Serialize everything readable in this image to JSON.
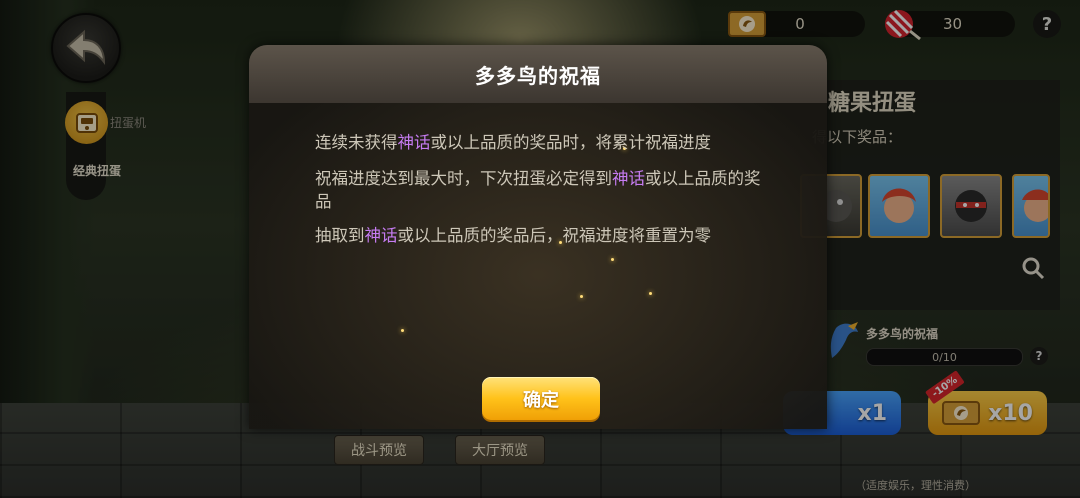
{
  "topbar": {
    "back_icon": "back-arrow-icon",
    "ticket_count": "0",
    "candy_count": "30",
    "help_label": "?"
  },
  "sidebar": {
    "tab_small_label": "扭蛋机",
    "tab_main_label": "经典扭蛋"
  },
  "panel": {
    "title": "糖果扭蛋",
    "subtitle": "得以下奖品：",
    "blessing_title": "多多鸟的祝福",
    "blessing_progress": "0/10",
    "blessing_progress_value": 0,
    "blessing_help": "?",
    "draw_x1_label": "x1",
    "draw_x10_label": "x10",
    "discount_label": "-10%",
    "footer_note": "（适度娱乐，理性消费）"
  },
  "bottom_buttons": {
    "battle_preview": "战斗预览",
    "lobby_preview": "大厅预览"
  },
  "modal": {
    "title": "多多鸟的祝福",
    "p1_a": "连续未获得",
    "p1_hl": "神话",
    "p1_b": "或以上品质的奖品时，将累计祝福进度",
    "p2_a": "祝福进度达到最大时，下次扭蛋必定得到",
    "p2_hl": "神话",
    "p2_b": "或以上品质的奖品",
    "p3_a": "抽取到",
    "p3_hl": "神话",
    "p3_b": "或以上品质的奖品后，祝福进度将重置为零",
    "confirm": "确定"
  },
  "colors": {
    "highlight": "#c67cf2",
    "confirm_button": "#ffc21a",
    "draw_x1": "#1c5fd9",
    "draw_x10": "#e59a10"
  }
}
